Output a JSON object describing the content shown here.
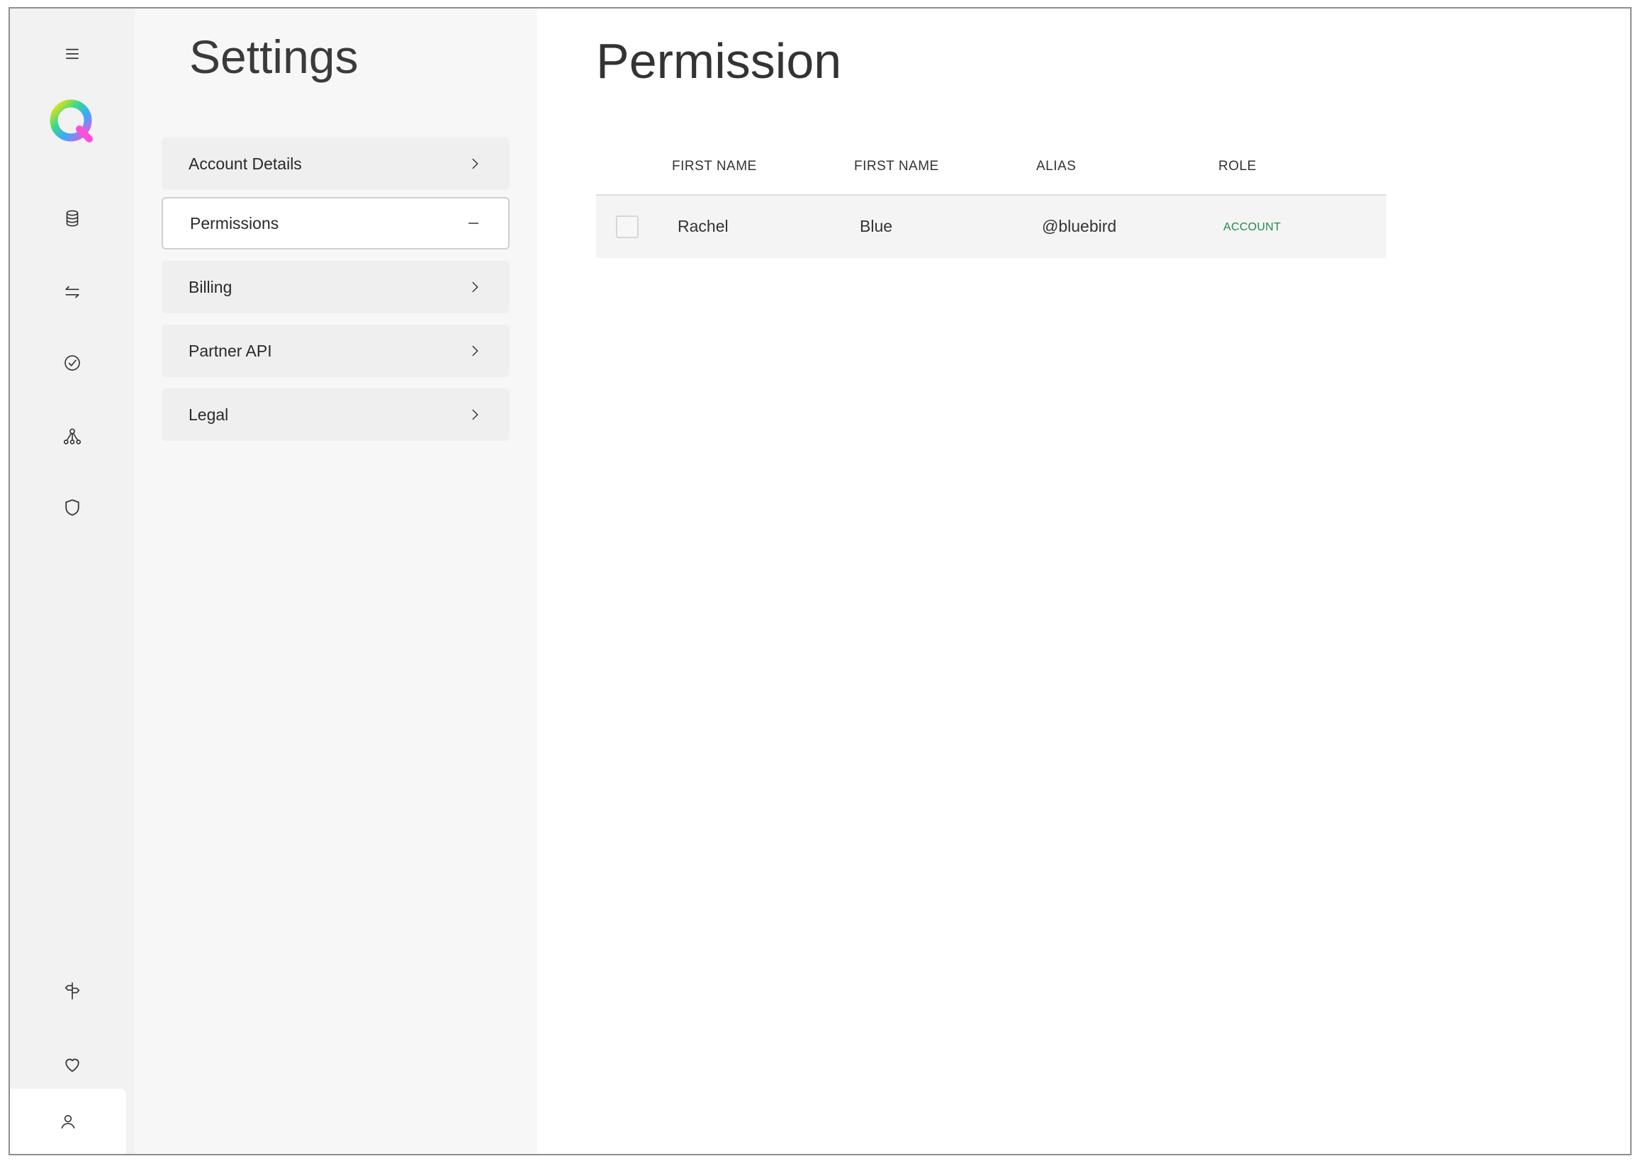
{
  "settings": {
    "title": "Settings",
    "menu": [
      {
        "label": "Account Details",
        "icon": "chevron-right-icon",
        "active": false
      },
      {
        "label": "Permissions",
        "icon": "minus-icon",
        "active": true
      },
      {
        "label": "Billing",
        "icon": "chevron-right-icon",
        "active": false
      },
      {
        "label": "Partner API",
        "icon": "chevron-right-icon",
        "active": false
      },
      {
        "label": "Legal",
        "icon": "chevron-right-icon",
        "active": false
      }
    ]
  },
  "main": {
    "title": "Permissions",
    "table": {
      "headers": [
        "FIRST NAME",
        "FIRST NAME",
        "ALIAS",
        "ROLE"
      ],
      "rows": [
        {
          "checked": false,
          "first_name": "Rachel",
          "last_name": "Blue",
          "alias": "@bluebird",
          "role": "ACCOUNT"
        }
      ]
    }
  },
  "rail": {
    "icons": [
      "menu-icon",
      "logo-icon",
      "database-icon",
      "transfer-icon",
      "check-circle-icon",
      "network-icon",
      "shield-icon",
      "signpost-icon",
      "heart-icon",
      "user-icon"
    ]
  },
  "colors": {
    "role_badge": "#1f8a4c",
    "logo_gradient": [
      "#ffe600",
      "#39d98a",
      "#3aa8ff",
      "#ff4fd8"
    ]
  }
}
